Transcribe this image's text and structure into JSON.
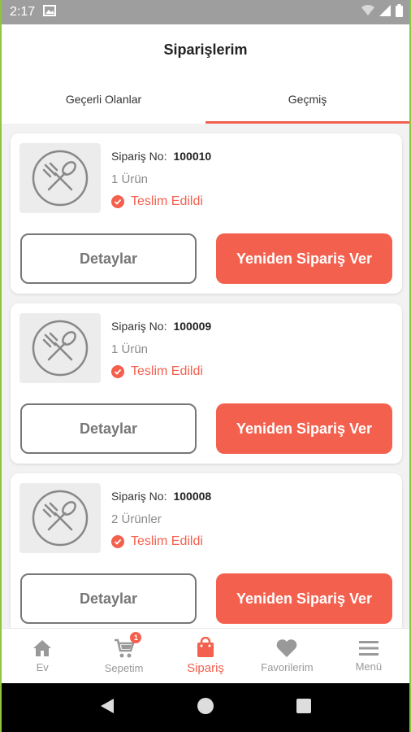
{
  "statusbar": {
    "time": "2:17"
  },
  "appbar": {
    "title": "Siparişlerim"
  },
  "tabs": [
    {
      "label": "Geçerli Olanlar",
      "active": false
    },
    {
      "label": "Geçmiş",
      "active": true
    }
  ],
  "orders": [
    {
      "order_label": "Sipariş No:",
      "order_no": "100010",
      "count": "1 Ürün",
      "status": "Teslim Edildi",
      "detail_label": "Detaylar",
      "reorder_label": "Yeniden Sipariş Ver"
    },
    {
      "order_label": "Sipariş No:",
      "order_no": "100009",
      "count": "1 Ürün",
      "status": "Teslim Edildi",
      "detail_label": "Detaylar",
      "reorder_label": "Yeniden Sipariş Ver"
    },
    {
      "order_label": "Sipariş No:",
      "order_no": "100008",
      "count": "2 Ürünler",
      "status": "Teslim Edildi",
      "detail_label": "Detaylar",
      "reorder_label": "Yeniden Sipariş Ver"
    }
  ],
  "bottom_nav": [
    {
      "label": "Ev",
      "icon": "home-icon"
    },
    {
      "label": "Sepetim",
      "icon": "cart-icon",
      "badge": "1"
    },
    {
      "label": "Sipariş",
      "icon": "bag-icon",
      "active": true
    },
    {
      "label": "Favorilerim",
      "icon": "heart-icon"
    },
    {
      "label": "Menü",
      "icon": "menu-icon"
    }
  ],
  "colors": {
    "accent": "#f4604e",
    "frame": "#8fc63f",
    "statusbar": "#9e9e9e"
  }
}
